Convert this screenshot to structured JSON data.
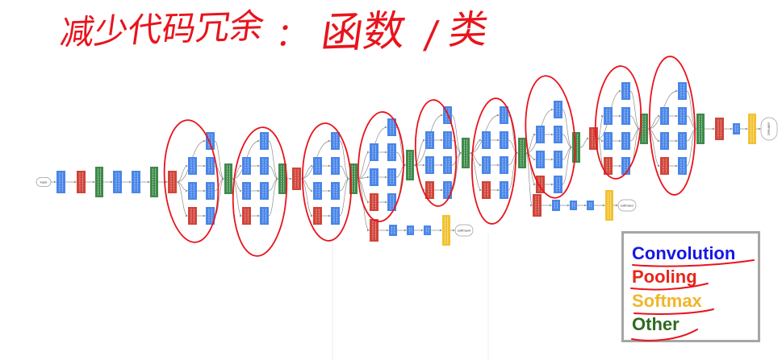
{
  "annotation": {
    "segments": [
      "减少代码冗余",
      "：",
      "函数",
      "/",
      "类"
    ]
  },
  "markup_color": "#e8141c",
  "diagram": {
    "colors": {
      "convolution": "#4a86e8",
      "pooling": "#d0453a",
      "softmax": "#f1c232",
      "other": "#3f8a4a",
      "terminal_border": "#9a9a9a",
      "connector": "#8c8c8c"
    },
    "terminals": {
      "input": "input",
      "softmax0": "softmax0",
      "softmax1": "softmax1",
      "softmax2": "softmax2"
    }
  },
  "legend": {
    "border_color": "#a6a6a6",
    "items": [
      {
        "label": "Convolution",
        "color": "#1616e8"
      },
      {
        "label": "Pooling",
        "color": "#e8261a"
      },
      {
        "label": "Softmax",
        "color": "#f1b52a"
      },
      {
        "label": "Other",
        "color": "#2e6b1f"
      }
    ]
  }
}
